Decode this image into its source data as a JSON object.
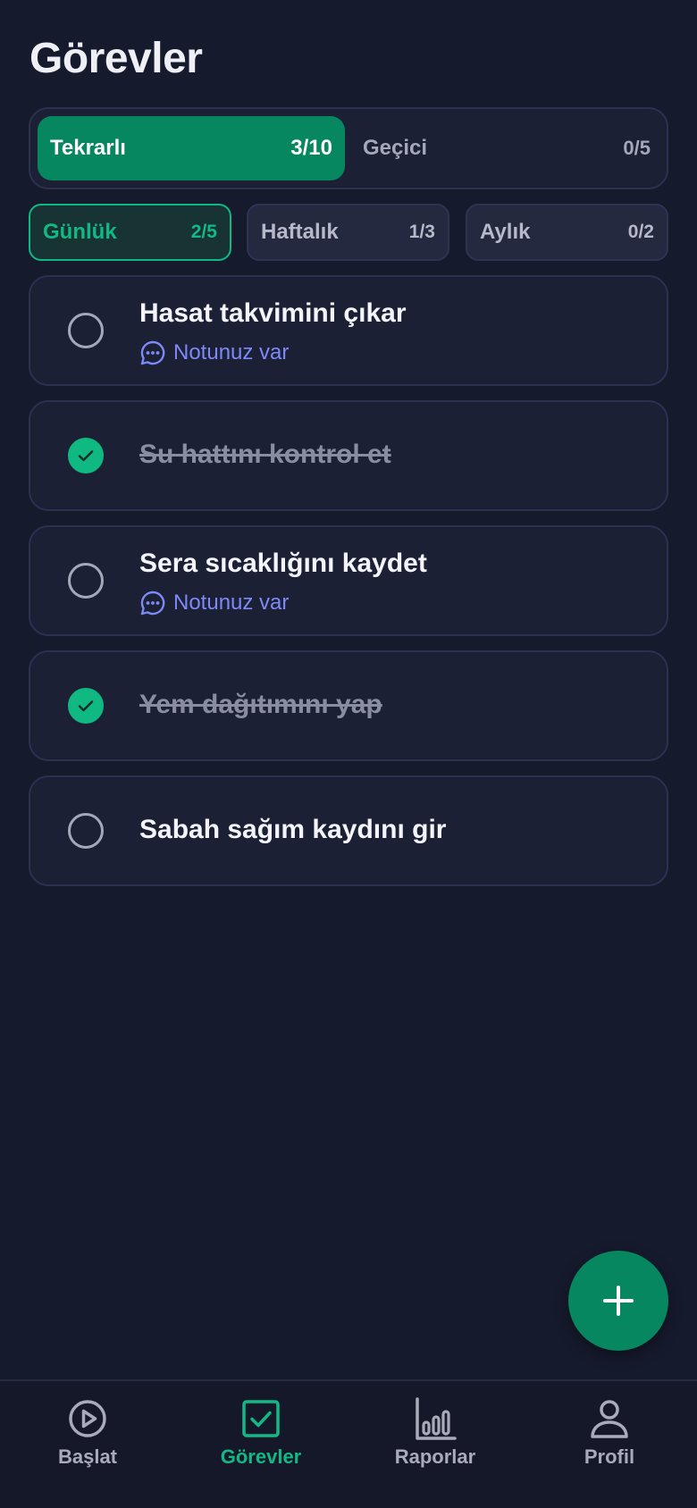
{
  "title": "Görevler",
  "segments": [
    {
      "label": "Tekrarlı",
      "count": "3/10",
      "active": true
    },
    {
      "label": "Geçici",
      "count": "0/5",
      "active": false
    }
  ],
  "periods": [
    {
      "label": "Günlük",
      "count": "2/5",
      "active": true
    },
    {
      "label": "Haftalık",
      "count": "1/3",
      "active": false
    },
    {
      "label": "Aylık",
      "count": "0/2",
      "active": false
    }
  ],
  "tasks": [
    {
      "title": "Hasat takvimini çıkar",
      "done": false,
      "note": "Notunuz var"
    },
    {
      "title": "Su hattını kontrol et",
      "done": true,
      "note": ""
    },
    {
      "title": "Sera sıcaklığını kaydet",
      "done": false,
      "note": "Notunuz var"
    },
    {
      "title": "Yem dağıtımını yap",
      "done": true,
      "note": ""
    },
    {
      "title": "Sabah sağım kaydını gir",
      "done": false,
      "note": ""
    }
  ],
  "fab": {
    "icon": "plus-icon"
  },
  "tabbar": [
    {
      "label": "Başlat",
      "icon": "play-icon",
      "active": false
    },
    {
      "label": "Görevler",
      "icon": "checkbox-icon",
      "active": true
    },
    {
      "label": "Raporlar",
      "icon": "bar-chart-icon",
      "active": false
    },
    {
      "label": "Profil",
      "icon": "user-icon",
      "active": false
    }
  ],
  "colors": {
    "accent": "#07875f",
    "accent_text": "#12b886",
    "note": "#7c89f6",
    "background": "#161a2d"
  }
}
